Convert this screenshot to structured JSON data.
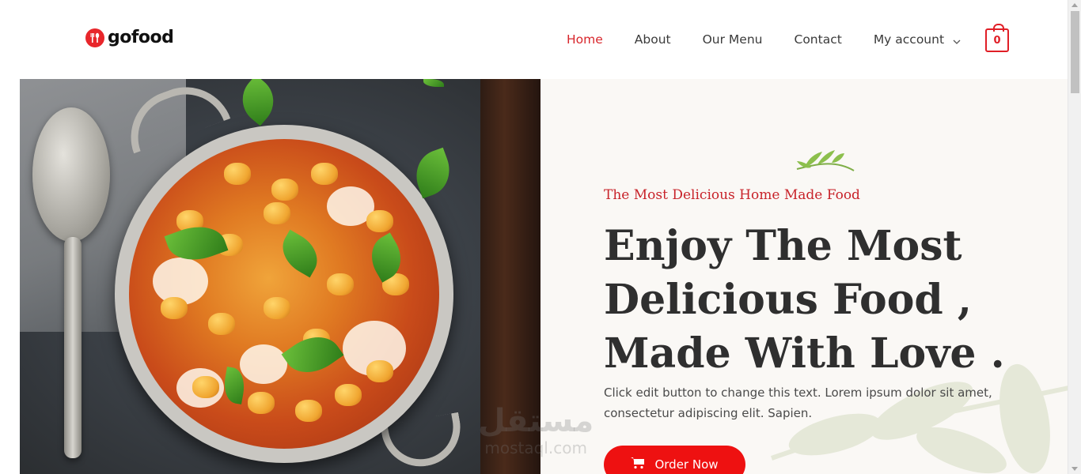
{
  "brand": {
    "name": "gofood",
    "accent": "#e8262b"
  },
  "nav": {
    "items": [
      {
        "label": "Home",
        "active": true
      },
      {
        "label": "About",
        "active": false
      },
      {
        "label": "Our Menu",
        "active": false
      },
      {
        "label": "Contact",
        "active": false
      },
      {
        "label": "My account",
        "active": false,
        "has_dropdown": true
      }
    ],
    "cart_count": "0"
  },
  "hero": {
    "tagline": "The Most Delicious Home Made Food",
    "headline": "Enjoy The Most Delicious Food , Made With Love .",
    "description": "Click edit button to change this text. Lorem ipsum dolor sit amet, consectetur adipiscing elit. Sapien.",
    "cta_label": "Order Now",
    "cta_color": "#ee1111"
  },
  "watermark": {
    "arabic": "مستقل",
    "latin": "mostaql.com"
  },
  "colors": {
    "heading": "#2f2f2f",
    "tagline": "#c8232a",
    "text": "#4a4a4a"
  }
}
